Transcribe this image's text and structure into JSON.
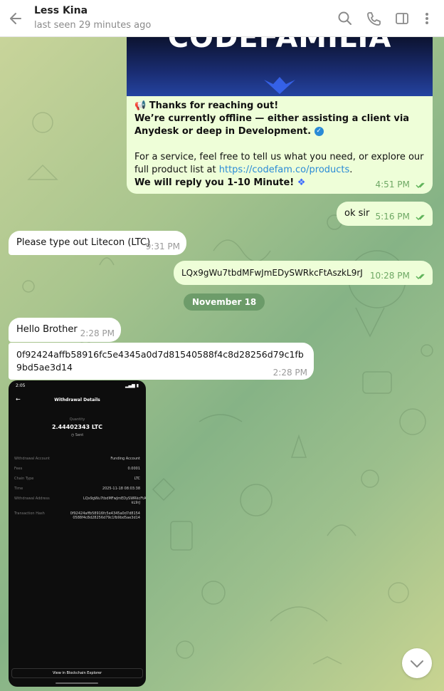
{
  "header": {
    "contact_name": "Less Kina",
    "status": "last seen 29 minutes ago"
  },
  "messages": {
    "promo": {
      "banner_text": "CODEFAMILIA",
      "line1": "Thanks for reaching out!",
      "line2": "We’re currently offline — either assisting a client via Anydesk or deep in Development.",
      "line3a": "For a service, feel free to tell us what you need, or explore our full product list at",
      "link": "https://codefam.co/products",
      "line3b": ".",
      "line4": "We will reply you 1-10 Minute!",
      "time": "4:51 PM"
    },
    "ok_sir": {
      "text": "ok sir",
      "time": "5:16 PM"
    },
    "litecoin_request": {
      "text": "Please type out Litecon (LTC)",
      "time": "9:31 PM"
    },
    "address": {
      "text": "LQx9gWu7tbdMFwJmEDySWRkcFtAszkL9rJ",
      "time": "10:28 PM"
    },
    "date_separator": "November 18",
    "hello": {
      "text": "Hello Brother",
      "time": "2:28 PM"
    },
    "hash": {
      "text": "0f92424affb58916fc5e4345a0d7d81540588f4c8d28256d79c1fb9bd5ae3d14",
      "time": "2:28 PM"
    }
  },
  "screenshot": {
    "status_time": "2:05",
    "screen_title": "Withdrawal Details",
    "quantity_label": "Quantity",
    "amount": "2.44402343 LTC",
    "status": "Sent",
    "rows": [
      {
        "label": "Withdrawal Account",
        "value": "Funding Account"
      },
      {
        "label": "Fees",
        "value": "0.0001"
      },
      {
        "label": "Chain Type",
        "value": "LTC"
      },
      {
        "label": "Time",
        "value": "2025-11-18 08:03:38"
      },
      {
        "label": "Withdrawal Address",
        "value": "LQx9gWu7tbdMFwJmEDySWRkcFtAsz kL9rJ"
      },
      {
        "label": "Transaction Hash",
        "value": "0f92424affb58916fc5e4345a0d7d8154 0588f4c8d28256d79c1fb9bd5ae3d14"
      }
    ],
    "button": "View in Blockchain Explorer"
  },
  "colors": {
    "outgoing_bubble": "#eefed8",
    "incoming_bubble": "#ffffff",
    "link": "#2a8bd6",
    "check": "#5fb35a"
  },
  "icons": [
    "back-arrow-icon",
    "search-icon",
    "phone-icon",
    "sidebar-toggle-icon",
    "more-vertical-icon",
    "scroll-down-icon"
  ]
}
